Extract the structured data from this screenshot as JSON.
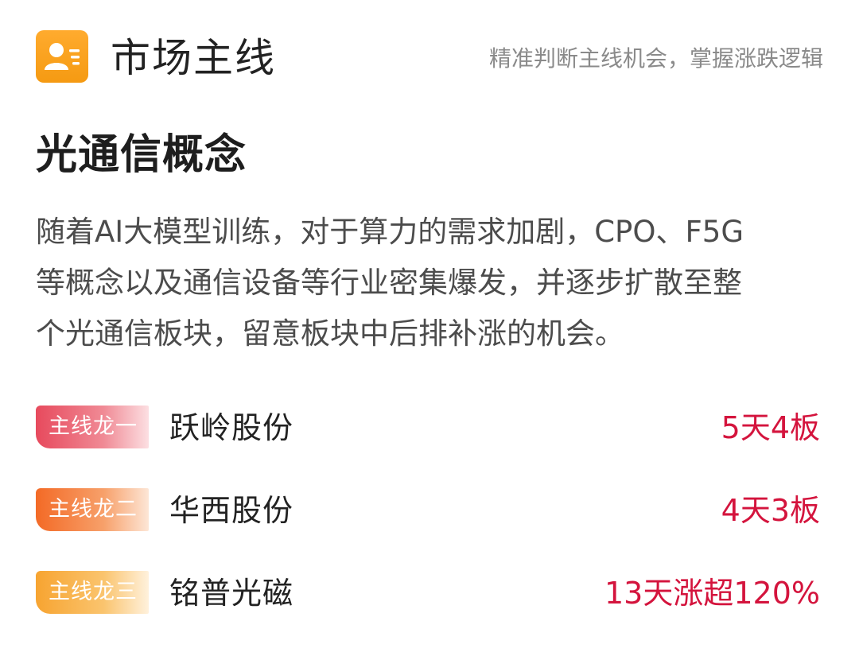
{
  "header": {
    "icon": "user-card-icon",
    "title": "市场主线",
    "slogan": "精准判断主线机会，掌握涨跌逻辑",
    "accent_color": "#f7a21b"
  },
  "section": {
    "title": "光通信概念",
    "description_lines": [
      "随着AI大模型训练，对于算力的需求加剧，CPO、F5G",
      "等概念以及通信设备等行业密集爆发，并逐步扩散至整",
      "个光通信板块，留意板块中后排补涨的机会。"
    ]
  },
  "leaders": [
    {
      "badge": "主线龙一",
      "name": "跃岭股份",
      "performance": "5天4板",
      "badge_color": "#e74a5d"
    },
    {
      "badge": "主线龙二",
      "name": "华西股份",
      "performance": "4天3板",
      "badge_color": "#f36a26"
    },
    {
      "badge": "主线龙三",
      "name": "铭普光磁",
      "performance": "13天涨超120%",
      "badge_color": "#f7a431"
    }
  ],
  "colors": {
    "performance_text": "#d4143d",
    "slogan_text": "#8a8a8a"
  }
}
